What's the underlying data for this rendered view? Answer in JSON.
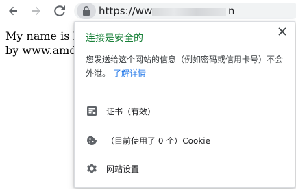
{
  "browser": {
    "url_prefix": "https://www",
    "url_suffix": "n"
  },
  "page": {
    "line1": "My name is B",
    "line2": "by www.amd"
  },
  "site_info": {
    "title": "连接是安全的",
    "description": "您发送给这个网站的信息（例如密码或信用卡号）不会外泄。",
    "learn_more": "了解详情",
    "rows": [
      {
        "icon": "certificate-icon",
        "label": "证书（有效）"
      },
      {
        "icon": "cookie-icon",
        "label": "（目前使用了 0 个）Cookie"
      },
      {
        "icon": "gear-icon",
        "label": "网站设置"
      }
    ]
  },
  "colors": {
    "secure_green": "#188038",
    "link_blue": "#1a73e8",
    "icon_gray": "#5f6368"
  }
}
